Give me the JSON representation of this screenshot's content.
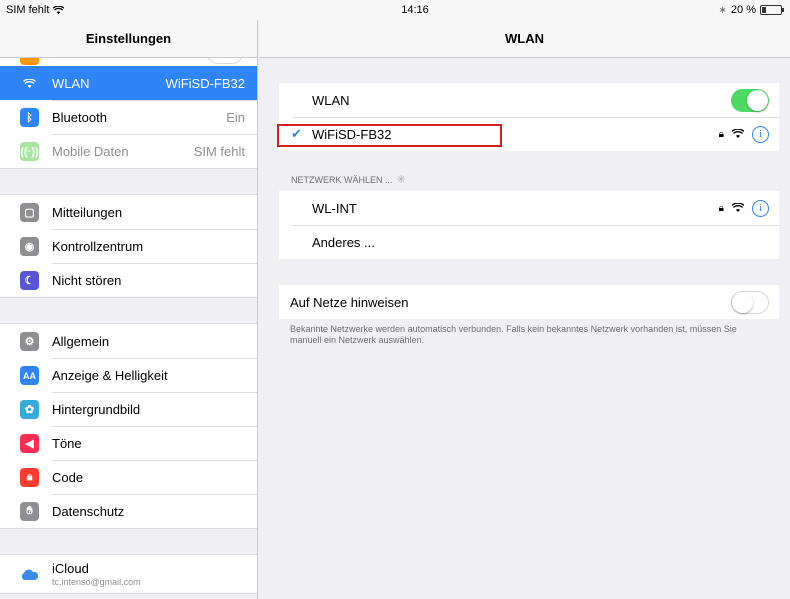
{
  "status_bar": {
    "carrier": "SIM fehlt",
    "time": "14:16",
    "battery_text": "20 %"
  },
  "sidebar": {
    "title": "Einstellungen",
    "groups": [
      {
        "items": [
          {
            "label": "WLAN",
            "value": "WiFiSD-FB32",
            "icon": "wifi-icon",
            "color": "#2f84f7",
            "selected": true
          },
          {
            "label": "Bluetooth",
            "value": "Ein",
            "icon": "bluetooth-icon",
            "color": "#2f84f7"
          },
          {
            "label": "Mobile Daten",
            "value": "SIM fehlt",
            "icon": "antenna-icon",
            "color": "#a8e6a0",
            "disabled": true
          }
        ]
      },
      {
        "items": [
          {
            "label": "Mitteilungen",
            "icon": "notifications-icon",
            "color": "#8e8e93"
          },
          {
            "label": "Kontrollzentrum",
            "icon": "control-center-icon",
            "color": "#8e8e93"
          },
          {
            "label": "Nicht stören",
            "icon": "moon-icon",
            "color": "#5856d6"
          }
        ]
      },
      {
        "items": [
          {
            "label": "Allgemein",
            "icon": "gear-icon",
            "color": "#8e8e93"
          },
          {
            "label": "Anzeige & Helligkeit",
            "icon": "display-icon",
            "color": "#2f84f7"
          },
          {
            "label": "Hintergrundbild",
            "icon": "wallpaper-icon",
            "color": "#35aadc"
          },
          {
            "label": "Töne",
            "icon": "sound-icon",
            "color": "#ff2d55"
          },
          {
            "label": "Code",
            "icon": "lock-icon",
            "color": "#ff3b30"
          },
          {
            "label": "Datenschutz",
            "icon": "hand-icon",
            "color": "#8e8e93"
          }
        ]
      },
      {
        "items": [
          {
            "label": "iCloud",
            "sublabel": "tc.intenso@gmail.com",
            "icon": "cloud-icon"
          }
        ]
      }
    ]
  },
  "detail": {
    "title": "WLAN",
    "wlan_label": "WLAN",
    "wlan_toggle": true,
    "connected_network": "WiFiSD-FB32",
    "choose_network_label": "NETZWERK WÄHLEN ...",
    "networks": [
      {
        "name": "WL-INT",
        "secured": true
      },
      {
        "name": "Anderes ..."
      }
    ],
    "ask_join_label": "Auf Netze hinweisen",
    "ask_join_toggle": false,
    "footer_note": "Bekannte Netzwerke werden automatisch verbunden. Falls kein bekanntes Netzwerk vorhanden ist, müssen Sie manuell ein Netzwerk auswählen."
  },
  "colors": {
    "accent": "#2f84f7",
    "toggle_on": "#4cd964",
    "highlight": "#d21f1f"
  }
}
